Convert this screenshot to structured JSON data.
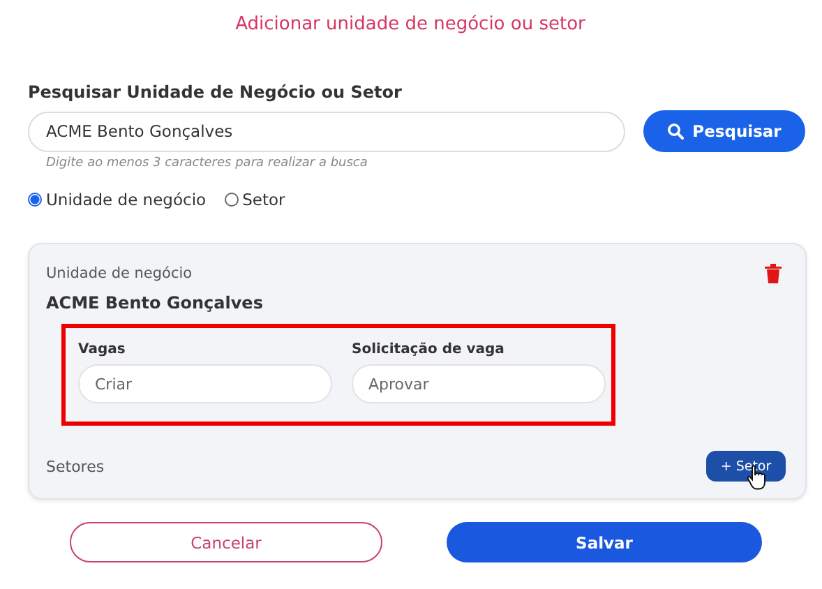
{
  "dialog": {
    "title": "Adicionar unidade de negócio ou setor"
  },
  "search": {
    "label": "Pesquisar Unidade de Negócio ou Setor",
    "value": "ACME Bento Gonçalves",
    "button": "Pesquisar",
    "hint": "Digite ao menos 3 caracteres para realizar a busca"
  },
  "type_options": [
    {
      "label": "Unidade de negócio",
      "selected": true
    },
    {
      "label": "Setor",
      "selected": false
    }
  ],
  "unit_card": {
    "caption": "Unidade de negócio",
    "name": "ACME Bento Gonçalves",
    "permissions": [
      {
        "label": "Vagas",
        "value": "Criar"
      },
      {
        "label": "Solicitação de vaga",
        "value": "Aprovar"
      }
    ],
    "sectors_label": "Setores",
    "add_sector_plus": "+",
    "add_sector_button": "Setor"
  },
  "buttons": {
    "cancel": "Cancelar",
    "save": "Salvar"
  }
}
